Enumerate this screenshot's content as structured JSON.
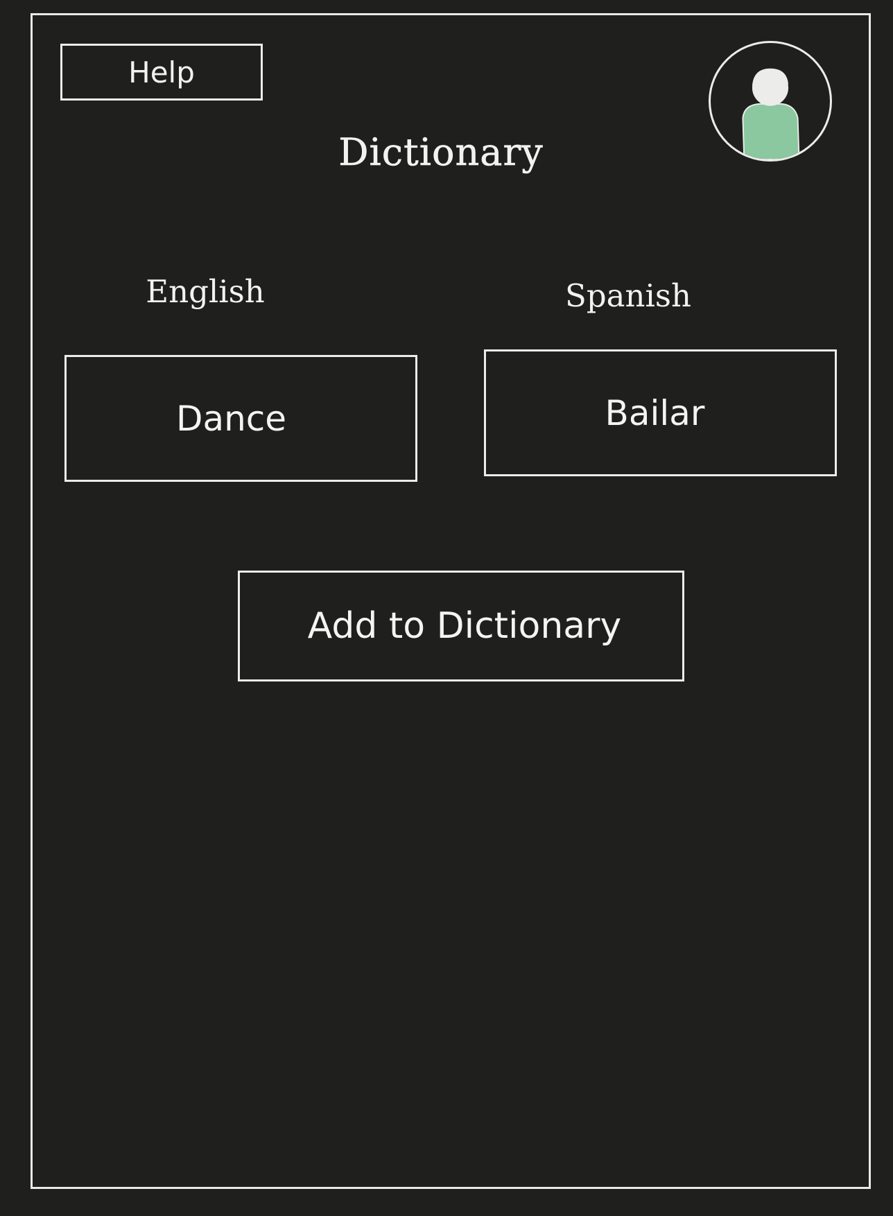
{
  "help_button": {
    "label": "Help"
  },
  "avatar": {
    "icon": "user-avatar-icon",
    "shirt_color": "#8bc79f",
    "head_color": "#ececea"
  },
  "page_title": "Dictionary",
  "languages": {
    "source": {
      "label": "English",
      "word": "Dance"
    },
    "target": {
      "label": "Spanish",
      "word": "Bailar"
    }
  },
  "add_button": {
    "label": "Add to Dictionary"
  },
  "colors": {
    "background": "#1f1f1e",
    "stroke": "#ececea"
  }
}
